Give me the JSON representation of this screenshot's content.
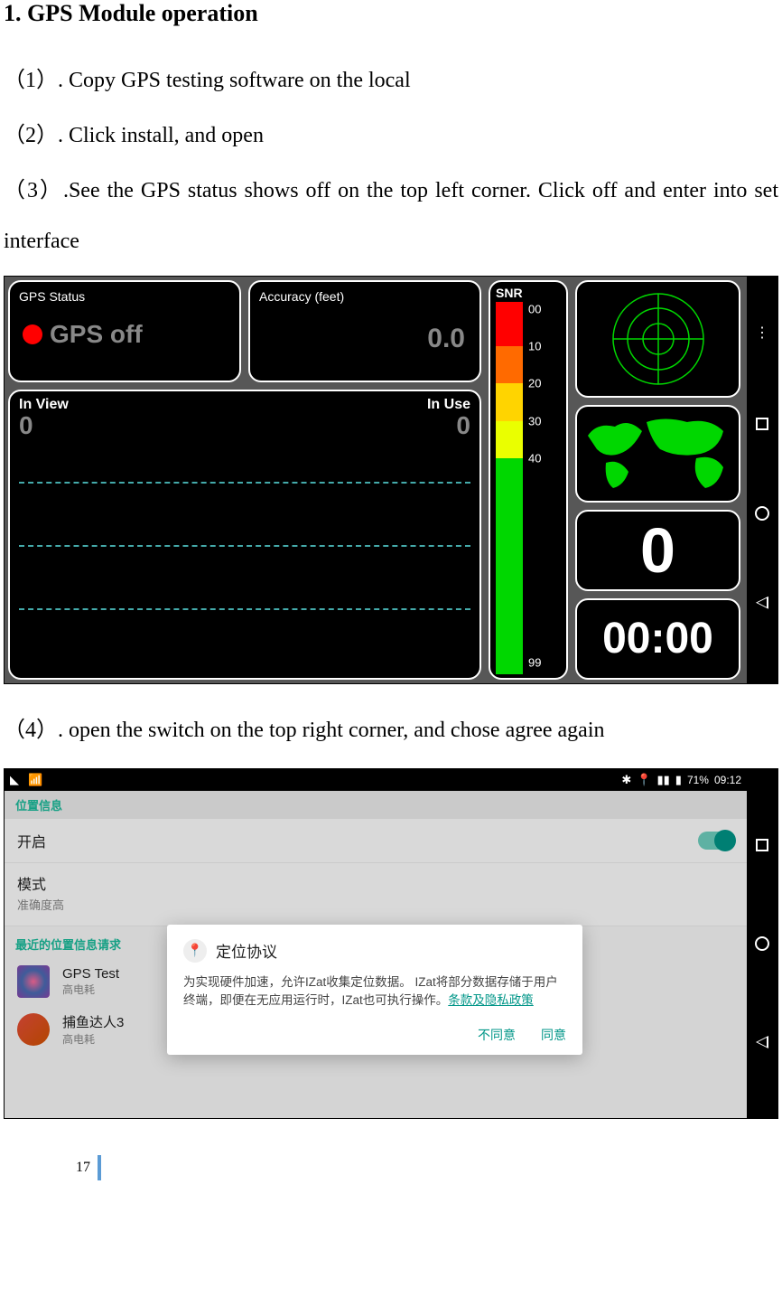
{
  "heading": "1. GPS Module operation",
  "steps": {
    "s1": "（1）. Copy GPS testing software on the local",
    "s2": "（2）. Click install, and open",
    "s3": "（3）.See the GPS status shows off on the top left corner. Click off and enter into set interface",
    "s4": "（4）. open the switch on the top right corner, and chose agree again"
  },
  "shot1": {
    "gps_status_label": "GPS Status",
    "gps_off_text": "GPS off",
    "accuracy_label": "Accuracy (feet)",
    "accuracy_value": "0.0",
    "in_view_label": "In View",
    "in_view_value": "0",
    "in_use_label": "In Use",
    "in_use_value": "0",
    "snr_label": "SNR",
    "snr_ticks": [
      "00",
      "10",
      "20",
      "30",
      "40",
      "99"
    ],
    "big_zero": "0",
    "time": "00:00"
  },
  "shot2": {
    "status_time": "09:12",
    "battery": "71%",
    "section_location": "位置信息",
    "toggle_on": "开启",
    "mode_label": "模式",
    "mode_value": "准确度高",
    "section_recent": "最近的位置信息请求",
    "app1_name": "GPS Test",
    "app1_desc": "高电耗",
    "app2_name": "捕鱼达人3",
    "app2_desc": "高电耗",
    "dialog_title": "定位协议",
    "dialog_body_1": "为实现硬件加速，允许IZat收集定位数据。 IZat将部分数据存储于用户终端，即便在无应用运行时，IZat也可执行操作。",
    "dialog_link": "条款及隐私政策",
    "btn_disagree": "不同意",
    "btn_agree": "同意"
  },
  "page_number": "17"
}
